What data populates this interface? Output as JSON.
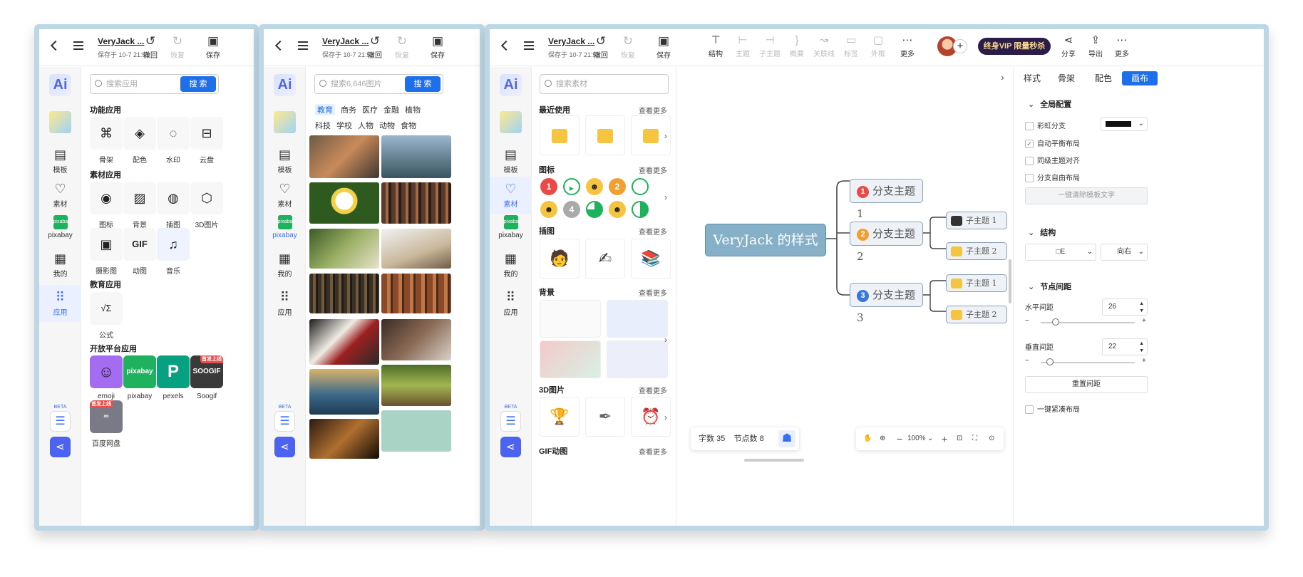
{
  "doc": {
    "title": "VeryJack ...",
    "saved": "保存于 10-7 21:51"
  },
  "toolbar": {
    "back": "‹",
    "menu": "≡",
    "undo": "撤回",
    "redo": "恢复",
    "save": "保存"
  },
  "sidebar": {
    "ai": "Ai",
    "template": "模板",
    "material": "素材",
    "pixabay": "pixabay",
    "pixabay_logo": "pixabay",
    "mine": "我的",
    "apps": "应用",
    "beta": "BETA"
  },
  "pane1": {
    "search_placeholder": "搜索应用",
    "search_button": "搜 索",
    "sections": {
      "func": "功能应用",
      "material": "素材应用",
      "edu": "教育应用",
      "open": "开放平台应用"
    },
    "func_apps": [
      "骨架",
      "配色",
      "水印",
      "云盘"
    ],
    "material_apps": [
      "图标",
      "背景",
      "插图",
      "3D图片",
      "摄影图",
      "动图",
      "音乐"
    ],
    "edu_apps": [
      "公式"
    ],
    "open_apps": [
      "emoji",
      "pixabay",
      "pexels",
      "Soogif",
      "百度网盘"
    ],
    "gif_icon": "GIF",
    "formula_icon": "√Σ",
    "pixabay_tile": "pixabay",
    "badge": "首发上线"
  },
  "pane2": {
    "search_placeholder": "搜索6,646图片",
    "search_button": "搜 索",
    "categories": [
      "教育",
      "商务",
      "医疗",
      "金融",
      "植物",
      "科技",
      "学校",
      "人物",
      "动物",
      "食物"
    ]
  },
  "pane3": {
    "toolbar2": [
      "结构",
      "主题",
      "子主题",
      "概要",
      "关联线",
      "标签",
      "外框",
      "更多"
    ],
    "vip": "终身VIP 限量秒杀",
    "share": "分享",
    "export": "导出",
    "more": "更多",
    "material_search": "搜索素材",
    "recent": "最近使用",
    "icons": "图标",
    "illustrations": "插图",
    "backgrounds": "背景",
    "three_d": "3D图片",
    "gif": "GIF动图",
    "see_more": "查看更多",
    "icon_numbers": [
      "1",
      "4",
      "2"
    ]
  },
  "mindmap": {
    "root": "VeryJack 的样式",
    "branches": [
      {
        "num": "1",
        "label": "分支主题 1",
        "color": "#e84a4a"
      },
      {
        "num": "2",
        "label": "分支主题 2",
        "color": "#f0a030"
      },
      {
        "num": "3",
        "label": "分支主题 3",
        "color": "#3a78d8"
      }
    ],
    "sub1": "子主题 1",
    "sub2": "子主题 2"
  },
  "status": {
    "words": "字数 35",
    "nodes": "节点数 8",
    "zoom": "100%"
  },
  "rpanel": {
    "tabs": [
      "样式",
      "骨架",
      "配色",
      "画布"
    ],
    "global": "全局配置",
    "rainbow": "彩虹分支",
    "autobalance": "自动平衡布局",
    "align": "同级主题对齐",
    "free": "分支自由布局",
    "clear_btn": "一键清除模板文字",
    "structure": "结构",
    "structure_val": "□E",
    "direction": "向右",
    "spacing": "节点间距",
    "h_spacing": "水平间距",
    "h_val": "26",
    "h_level": 0.12,
    "v_spacing": "垂直间距",
    "v_val": "22",
    "v_level": 0.06,
    "reset": "重置间距",
    "compact": "一键紧凑布局"
  }
}
